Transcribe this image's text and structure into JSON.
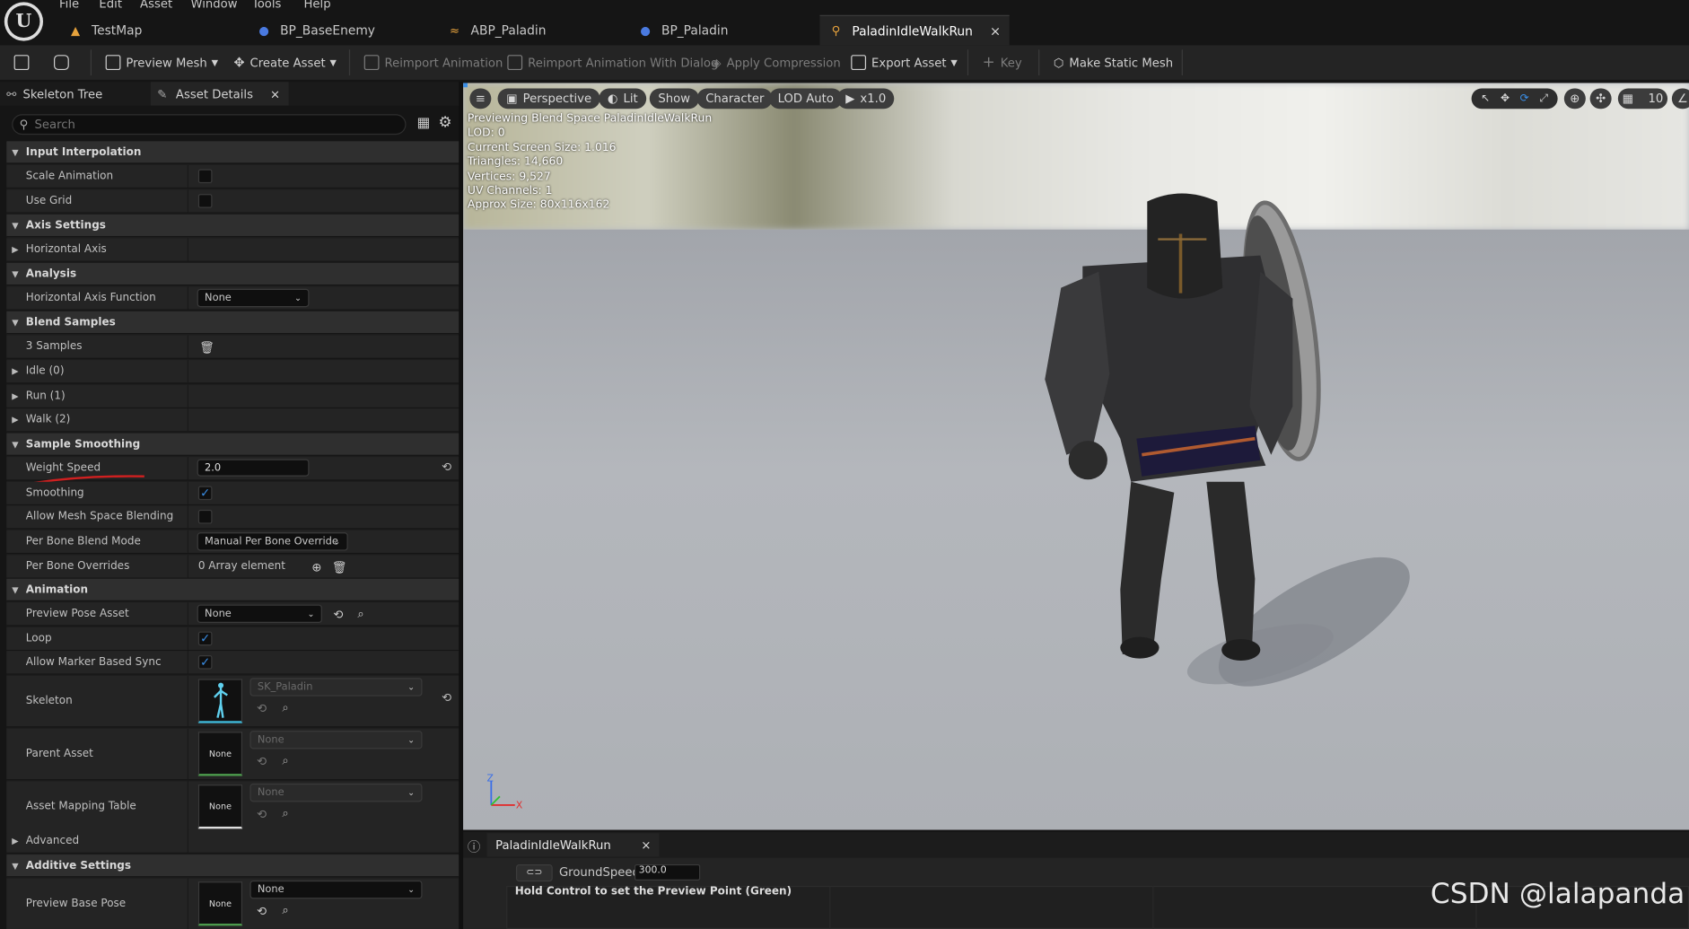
{
  "menu": [
    "File",
    "Edit",
    "Asset",
    "Window",
    "Tools",
    "Help"
  ],
  "tabs": [
    {
      "label": "TestMap",
      "icon": "map-icon"
    },
    {
      "label": "BP_BaseEnemy",
      "icon": "blueprint-icon"
    },
    {
      "label": "ABP_Paladin",
      "icon": "anim-blueprint-icon"
    },
    {
      "label": "BP_Paladin",
      "icon": "blueprint-icon"
    },
    {
      "label": "PaladinIdleWalkRun",
      "icon": "blendspace-icon",
      "close": "×"
    }
  ],
  "toolbar": {
    "preview_mesh": "Preview Mesh",
    "create_asset": "Create Asset",
    "reimport": "Reimport Animation",
    "reimport_dialog": "Reimport Animation With Dialog",
    "apply_compression": "Apply Compression",
    "export_asset": "Export Asset",
    "key": "Key",
    "make_static_mesh": "Make Static Mesh"
  },
  "left_tabs": {
    "skeleton_tree": "Skeleton Tree",
    "asset_details": "Asset Details",
    "close": "×"
  },
  "search": {
    "placeholder": "Search"
  },
  "details": {
    "input_interpolation": "Input Interpolation",
    "scale_animation": "Scale Animation",
    "use_grid": "Use Grid",
    "axis_settings": "Axis Settings",
    "horizontal_axis": "Horizontal Axis",
    "analysis": "Analysis",
    "horizontal_axis_function": "Horizontal Axis Function",
    "horizontal_axis_function_value": "None",
    "blend_samples": "Blend Samples",
    "samples_count": "3 Samples",
    "idle": "Idle (0)",
    "run": "Run (1)",
    "walk": "Walk (2)",
    "sample_smoothing": "Sample Smoothing",
    "weight_speed": "Weight Speed",
    "weight_speed_value": "2.0",
    "smoothing": "Smoothing",
    "allow_mesh_space_blending": "Allow Mesh Space Blending",
    "per_bone_blend_mode": "Per Bone Blend Mode",
    "per_bone_blend_mode_value": "Manual Per Bone Override",
    "per_bone_overrides": "Per Bone Overrides",
    "per_bone_overrides_value": "0 Array element",
    "animation": "Animation",
    "preview_pose_asset": "Preview Pose Asset",
    "preview_pose_asset_value": "None",
    "loop": "Loop",
    "allow_marker_based_sync": "Allow Marker Based Sync",
    "skeleton": "Skeleton",
    "skeleton_value": "SK_Paladin",
    "parent_asset": "Parent Asset",
    "parent_asset_value": "None",
    "parent_asset_thumb": "None",
    "asset_mapping_table": "Asset Mapping Table",
    "asset_mapping_table_value": "None",
    "asset_mapping_table_thumb": "None",
    "advanced": "Advanced",
    "additive_settings": "Additive Settings",
    "preview_base_pose": "Preview Base Pose",
    "preview_base_pose_value": "None",
    "preview_base_pose_thumb": "None"
  },
  "checkboxes": {
    "scale_animation": false,
    "use_grid": false,
    "smoothing": true,
    "allow_mesh_space_blending": false,
    "loop": true,
    "allow_marker_based_sync": true
  },
  "viewport": {
    "perspective": "Perspective",
    "lit": "Lit",
    "show": "Show",
    "character": "Character",
    "lod": "LOD Auto",
    "speed": "x1.0",
    "grid_value": "10",
    "stats": [
      "Previewing Blend Space PaladinIdleWalkRun",
      "LOD: 0",
      "Current Screen Size: 1.016",
      "Triangles: 14,660",
      "Vertices: 9,527",
      "UV Channels: 1",
      "Approx Size: 80x116x162"
    ],
    "axis_z": "Z",
    "axis_x": "X"
  },
  "bottom": {
    "tab": "PaladinIdleWalkRun",
    "close": "×",
    "param_label": "GroundSpeed",
    "param_value": "300.0",
    "hint": "Hold Control to set the Preview Point (Green)"
  },
  "watermark": "CSDN @lalapanda",
  "colors": {
    "accent": "#3a8fe8",
    "annotation": "#d02020"
  }
}
